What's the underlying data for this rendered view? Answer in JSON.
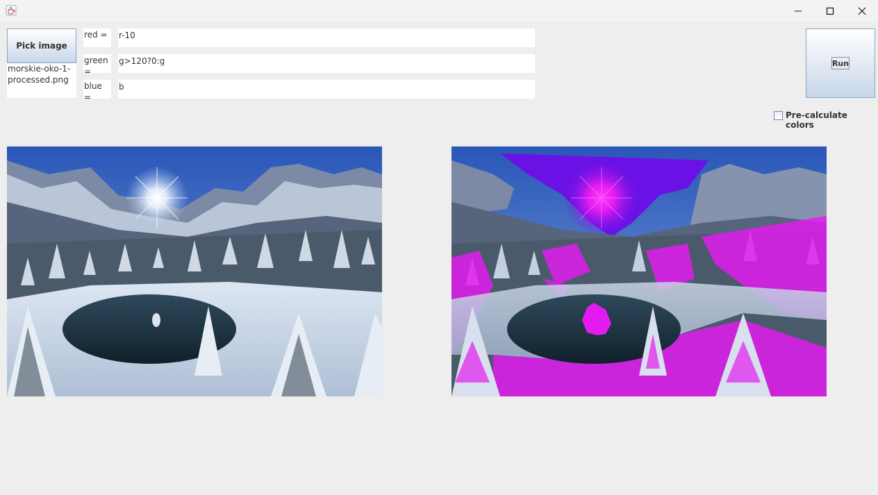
{
  "window": {
    "icon": "java-cup-icon",
    "minimize": "minimize-icon",
    "maximize": "maximize-icon",
    "close": "close-icon"
  },
  "picker": {
    "button_label": "Pick image",
    "filename": "morskie-oko-1-\nprocessed.png"
  },
  "formulas": [
    {
      "label": "red =",
      "value": "r-10"
    },
    {
      "label": "green =",
      "value": "g>120?0:g"
    },
    {
      "label": "blue =",
      "value": "b"
    }
  ],
  "run": {
    "label": "Run"
  },
  "precalc": {
    "label": "Pre-calculate colors",
    "checked": false
  },
  "images": {
    "original": {
      "icon": "landscape-image"
    },
    "processed": {
      "icon": "landscape-image-processed"
    }
  },
  "colors": {
    "background": "#eeeeee",
    "button_border": "#8aa4c3",
    "magenta": "#e21cf0"
  }
}
